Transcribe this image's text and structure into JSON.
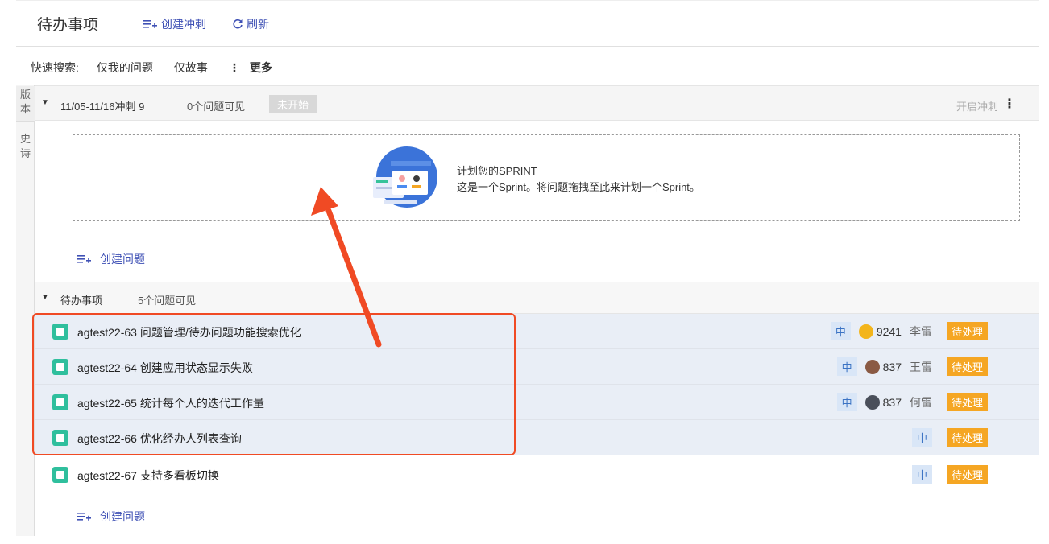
{
  "header": {
    "title": "待办事项",
    "create_sprint": "创建冲刺",
    "refresh": "刷新"
  },
  "quick_search": {
    "label": "快速搜索:",
    "filters": [
      "仅我的问题",
      "仅故事"
    ],
    "more": "更多"
  },
  "side_tabs": [
    "版本",
    "史诗"
  ],
  "sprint": {
    "name": "11/05-11/16冲刺 9",
    "count": "0个问题可见",
    "status": "未开始",
    "start": "开启冲刺",
    "empty_title": "计划您的SPRINT",
    "empty_desc": "这是一个Sprint。将问题拖拽至此来计划一个Sprint。",
    "create_issue": "创建问题"
  },
  "backlog": {
    "name": "待办事项",
    "count": "5个问题可见",
    "create_issue": "创建问题",
    "issues": [
      {
        "key": "agtest22-63",
        "summary": "问题管理/待办问题功能搜索优化",
        "priority": "中",
        "points": "9241",
        "assignee": "李雷",
        "status": "待处理",
        "avatar_color": "#f3b51b"
      },
      {
        "key": "agtest22-64",
        "summary": "创建应用状态显示失败",
        "priority": "中",
        "points": "837",
        "assignee": "王雷",
        "status": "待处理",
        "avatar_color": "#8a5a44"
      },
      {
        "key": "agtest22-65",
        "summary": "统计每个人的迭代工作量",
        "priority": "中",
        "points": "837",
        "assignee": "何雷",
        "status": "待处理",
        "avatar_color": "#4a4f5a"
      },
      {
        "key": "agtest22-66",
        "summary": "优化经办人列表查询",
        "priority": "中",
        "points": "",
        "assignee": "",
        "status": "待处理",
        "avatar_color": ""
      },
      {
        "key": "agtest22-67",
        "summary": "支持多看板切换",
        "priority": "中",
        "points": "",
        "assignee": "",
        "status": "待处理",
        "avatar_color": ""
      }
    ]
  },
  "colors": {
    "accent": "#3f51b5",
    "status": "#f5a623",
    "issue_icon": "#2fbf9d",
    "annotation": "#f04a24"
  }
}
